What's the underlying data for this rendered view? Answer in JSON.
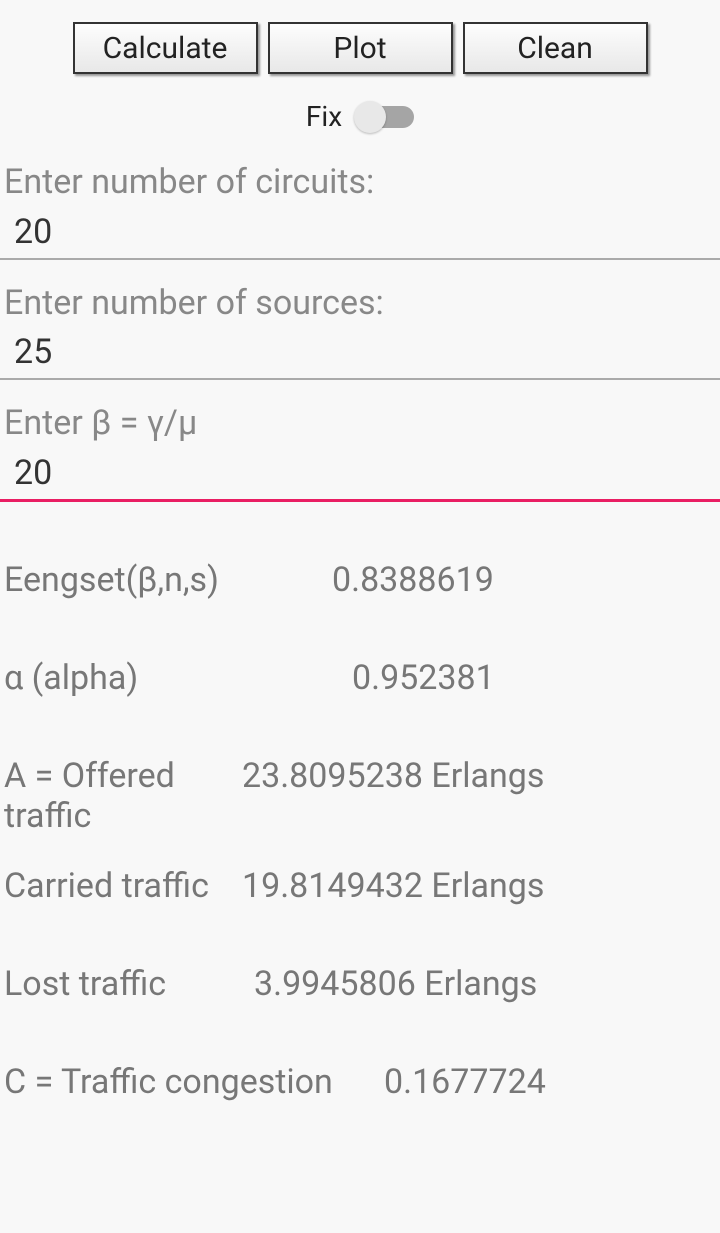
{
  "buttons": {
    "calculate": "Calculate",
    "plot": "Plot",
    "clean": "Clean"
  },
  "fix": {
    "label": "Fix",
    "on": false
  },
  "inputs": {
    "circuits": {
      "label": "Enter number of circuits:",
      "value": "20"
    },
    "sources": {
      "label": "Enter number of sources:",
      "value": "25"
    },
    "beta": {
      "label": "Enter β = γ/μ",
      "value": "20"
    }
  },
  "results": {
    "eengset": {
      "label": "Eengset(β,n,s)",
      "value": "0.8388619"
    },
    "alpha": {
      "label": "α (alpha)",
      "value": "0.952381"
    },
    "offered": {
      "label": "A = Offered traffic",
      "value": "23.8095238 Erlangs"
    },
    "carried": {
      "label": "Carried traffic",
      "value": "19.8149432 Erlangs"
    },
    "lost": {
      "label": "Lost traffic",
      "value": "3.9945806 Erlangs"
    },
    "congestion": {
      "label": "C = Traffic congestion",
      "value": "0.1677724"
    }
  }
}
